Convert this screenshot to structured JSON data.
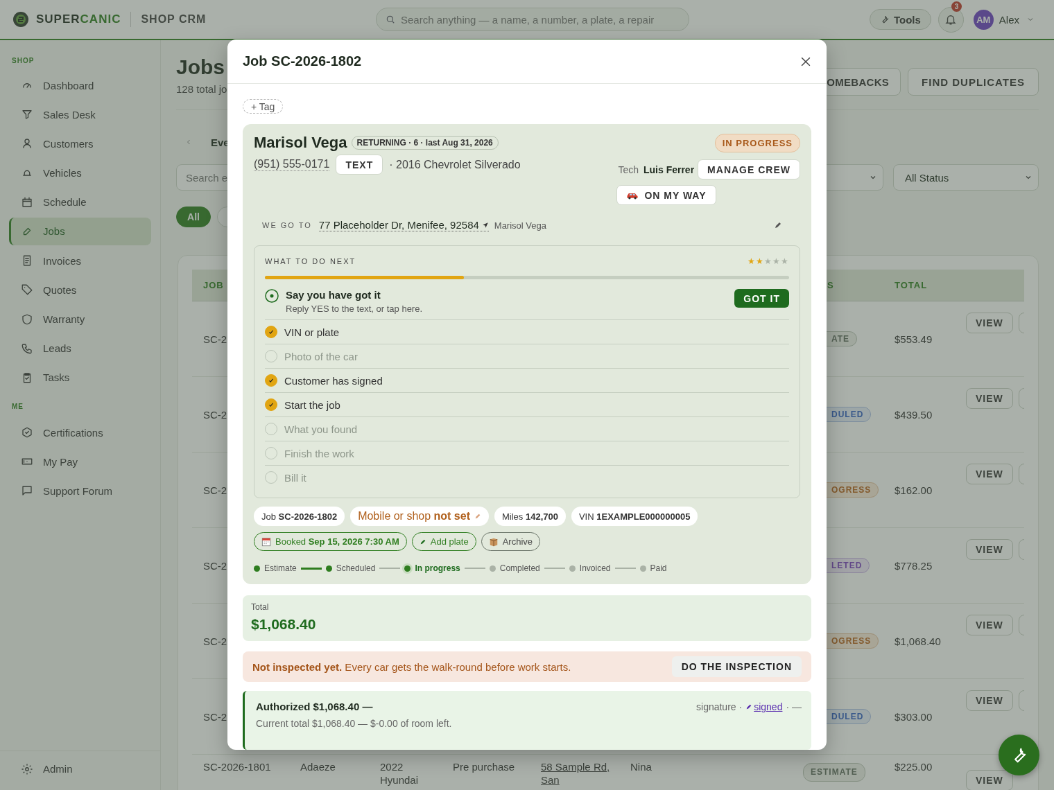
{
  "topbar": {
    "brand_first": "SUPER",
    "brand_second": "CANIC",
    "product": "SHOP CRM",
    "search_placeholder": "Search anything — a name, a number, a plate, a repair",
    "tools": "Tools",
    "notification_count": "3",
    "user_initials": "AM",
    "user_name": "Alex"
  },
  "sidebar": {
    "sections": [
      {
        "heading": "SHOP",
        "items": [
          {
            "label": "Dashboard",
            "selected": false
          },
          {
            "label": "Sales Desk",
            "selected": false
          },
          {
            "label": "Customers",
            "selected": false
          },
          {
            "label": "Vehicles",
            "selected": false
          },
          {
            "label": "Schedule",
            "selected": false
          },
          {
            "label": "Jobs",
            "selected": true
          },
          {
            "label": "Invoices",
            "selected": false
          },
          {
            "label": "Quotes",
            "selected": false
          },
          {
            "label": "Warranty",
            "selected": false
          },
          {
            "label": "Leads",
            "selected": false
          },
          {
            "label": "Tasks",
            "selected": false
          }
        ]
      },
      {
        "heading": "ME",
        "items": [
          {
            "label": "Certifications",
            "selected": false
          },
          {
            "label": "My Pay",
            "selected": false
          },
          {
            "label": "Support Forum",
            "selected": false
          }
        ]
      }
    ],
    "footer_item": "Admin"
  },
  "jobs_page": {
    "title": "Jobs",
    "subtitle": "128 total jo",
    "header_buttons": [
      "OMEBACKS",
      "FIND DUPLICATES"
    ],
    "nav_label": "Eve",
    "search_placeholder": "Search e",
    "status_select": "All Status",
    "chips": [
      {
        "label": "All",
        "selected": true
      },
      {
        "selected": false
      }
    ],
    "table": {
      "columns": {
        "job": "JOB",
        "status": "S",
        "total": "TOTAL"
      },
      "rows": [
        {
          "job": "SC-2",
          "status": "ATE",
          "kind": "estimate",
          "total": "$553.49",
          "action": "VIEW"
        },
        {
          "job": "SC-2",
          "status": "DULED",
          "kind": "scheduled",
          "total": "$439.50",
          "action": "VIEW"
        },
        {
          "job": "SC-2",
          "status": "OGRESS",
          "kind": "progress",
          "total": "$162.00",
          "action": "VIEW"
        },
        {
          "job": "SC-2",
          "status": "LETED",
          "kind": "completed",
          "total": "$778.25",
          "action": "VIEW"
        },
        {
          "job": "SC-2",
          "status": "OGRESS",
          "kind": "progress",
          "total": "$1,068.40",
          "action": "VIEW"
        },
        {
          "job": "SC-2",
          "status": "DULED",
          "kind": "scheduled",
          "total": "$303.00",
          "action": "VIEW"
        },
        {
          "job": "SC-2026-1801",
          "customer": "Adaeze",
          "vehicle": "2022 Hyundai",
          "service": "Pre purchase",
          "address": "58 Sample Rd, San",
          "tech": "Nina",
          "status": "ESTIMATE",
          "kind": "estimate",
          "total": "$225.00",
          "action": "VIEW"
        }
      ]
    }
  },
  "job_modal": {
    "title": "Job SC-2026-1802",
    "tag_button": "+ Tag",
    "customer": {
      "name": "Marisol Vega",
      "history_badge": "RETURNING · 6 · last Aug 31, 2026",
      "phone": "(951) 555-0171",
      "text_button": "TEXT",
      "vehicle": "· 2016 Chevrolet Silverado",
      "status": "IN PROGRESS",
      "tech_label": "Tech",
      "tech_name": "Luis Ferrer",
      "crew_button": "MANAGE CREW",
      "on_my_way_button": "ON MY WAY"
    },
    "address": {
      "label": "WE GO TO",
      "street": "77 Placeholder Dr, Menifee, 92584",
      "contact": "Marisol Vega"
    },
    "next_steps": {
      "title": "WHAT TO DO NEXT",
      "stars": 2,
      "level": 0.38,
      "steps": [
        {
          "kind": "current",
          "title": "Say you have got it",
          "hint": "Reply YES to the text, or tap here.",
          "button": "GOT IT"
        },
        {
          "kind": "task",
          "label": "VIN or plate",
          "checked": true
        },
        {
          "kind": "task",
          "label": "Photo of the car",
          "checked": false
        },
        {
          "kind": "task",
          "label": "Customer has signed",
          "checked": true
        },
        {
          "kind": "task",
          "label": "Start the job",
          "checked": true
        },
        {
          "kind": "task",
          "label": "What you found",
          "checked": false
        },
        {
          "kind": "task",
          "label": "Finish the work",
          "checked": false
        },
        {
          "kind": "task",
          "label": "Bill it",
          "checked": false
        }
      ]
    },
    "facts": [
      {
        "kind": "plain",
        "text": "Job **SC-2026-1802**"
      },
      {
        "kind": "unset",
        "text": "Mobile or shop **not set**"
      },
      {
        "kind": "plain",
        "text": "Miles **142,700**"
      },
      {
        "kind": "plain",
        "text": "VIN **1EXAMPLE000000005**"
      }
    ],
    "actions": [
      {
        "kind": "booked",
        "text": "Booked **Sep 15, 2026 7:30 AM**"
      },
      {
        "kind": "add",
        "text": "Add plate"
      },
      {
        "kind": "archive",
        "text": "Archive"
      }
    ],
    "stages": [
      {
        "label": "Estimate",
        "done": true,
        "selected": false
      },
      {
        "label": "Scheduled",
        "done": true,
        "selected": false
      },
      {
        "label": "In progress",
        "done": false,
        "selected": true
      },
      {
        "label": "Completed",
        "done": false,
        "selected": false
      },
      {
        "label": "Invoiced",
        "done": false,
        "selected": false
      },
      {
        "label": "Paid",
        "done": false,
        "selected": false
      }
    ],
    "total": {
      "label": "Total",
      "amount": "$1,068.40"
    },
    "inspection_alert": {
      "text": "**Not inspected yet.** Every car gets the walk-round before work starts.",
      "button": "DO THE INSPECTION"
    },
    "authorization": {
      "title": "Authorized $1,068.40 —",
      "detail": "Current total $1,068.40 — $-0.00 of room left.",
      "signature_label": "signature ·",
      "signature_link": "signed",
      "signature_tail": "· —"
    }
  }
}
